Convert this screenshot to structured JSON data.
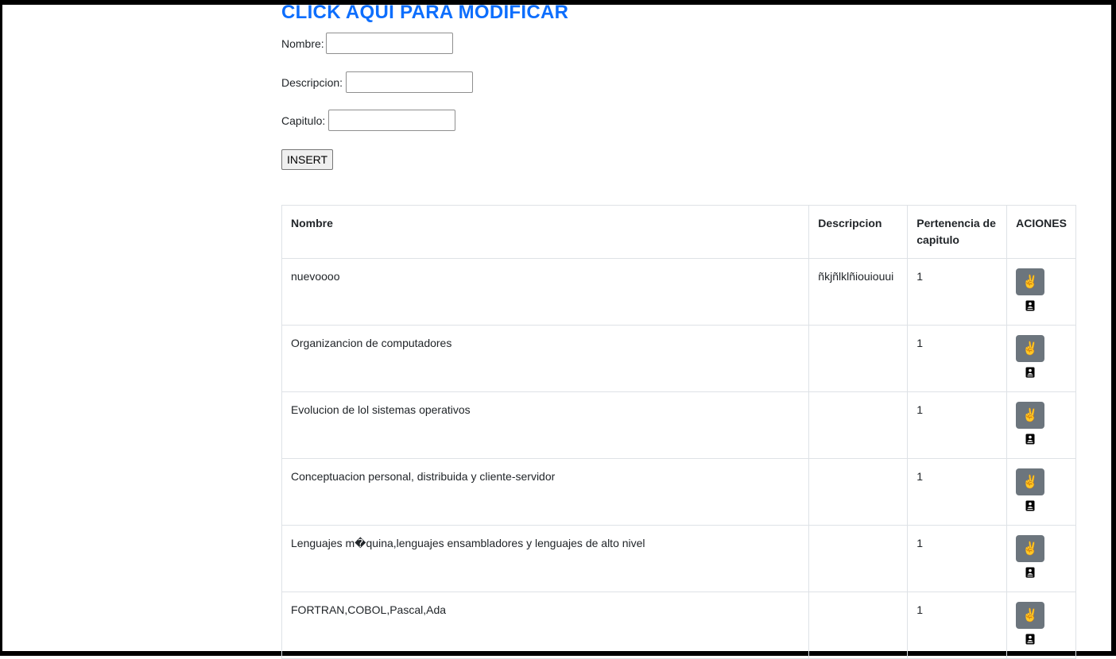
{
  "header": {
    "title_link": "CLICK AQUI PARA MODIFICAR"
  },
  "form": {
    "nombre_label": "Nombre:",
    "descripcion_label": "Descripcion:",
    "capitulo_label": "Capitulo:",
    "nombre_value": "",
    "descripcion_value": "",
    "capitulo_value": "",
    "insert_label": "INSERT"
  },
  "table": {
    "headers": [
      "Nombre",
      "Descripcion",
      "Pertenencia de capitulo",
      "ACIONES"
    ],
    "rows": [
      {
        "nombre": "nuevoooo",
        "descripcion": "ñkjñlklñiouiouui",
        "capitulo": "1"
      },
      {
        "nombre": "Organizancion de computadores",
        "descripcion": "",
        "capitulo": "1"
      },
      {
        "nombre": "Evolucion de lol sistemas operativos",
        "descripcion": "",
        "capitulo": "1"
      },
      {
        "nombre": "Conceptuacion personal, distribuida y cliente-servidor",
        "descripcion": "",
        "capitulo": "1"
      },
      {
        "nombre": "Lenguajes m�quina,lenguajes ensambladores y lenguajes de alto nivel",
        "descripcion": "",
        "capitulo": "1"
      },
      {
        "nombre": "FORTRAN,COBOL,Pascal,Ada",
        "descripcion": "",
        "capitulo": "1"
      }
    ],
    "action_icons": [
      "victory-hand-icon",
      "document-user-icon"
    ]
  },
  "colors": {
    "link": "#0d6efd",
    "action_button": "#6c757d",
    "frame": "#000000"
  }
}
